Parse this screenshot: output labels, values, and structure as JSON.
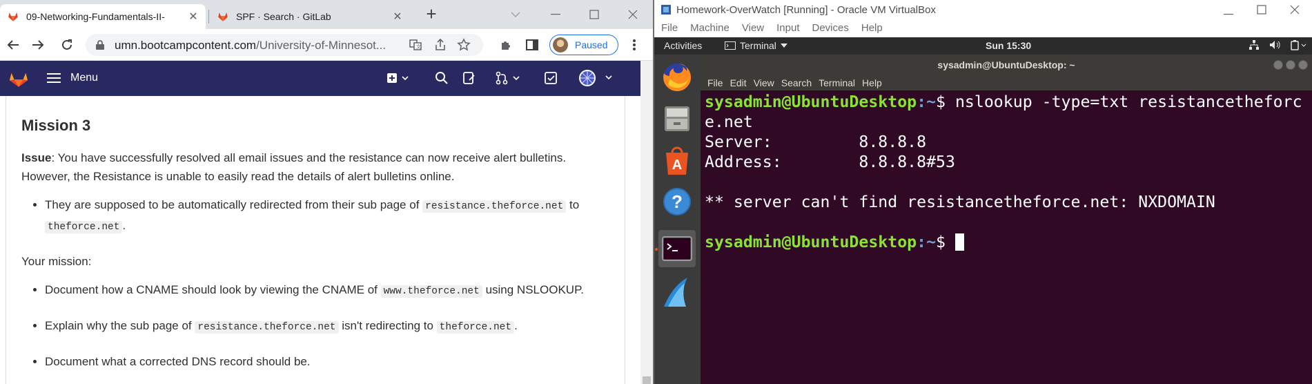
{
  "browser": {
    "tabs": [
      {
        "title": "09-Networking-Fundamentals-II-",
        "active": true
      },
      {
        "title": "SPF · Search · GitLab",
        "active": false
      }
    ],
    "address": {
      "host": "umn.bootcampcontent.com",
      "path": "/University-of-Minnesot..."
    },
    "profile": {
      "status": "Paused"
    },
    "gitlab_nav": {
      "menu_label": "Menu"
    }
  },
  "doc": {
    "heading": "Mission 3",
    "issue_label": "Issue",
    "issue_text": ": You have successfully resolved all email issues and the resistance can now receive alert bulletins. However, the Resistance is unable to easily read the details of alert bulletins online.",
    "bullet1": {
      "pre": "They are supposed to be automatically redirected from their sub page of ",
      "code1": "resistance.theforce.net",
      "mid": " to ",
      "code2": "theforce.net",
      "post": "."
    },
    "your_mission": "Your mission:",
    "bullet2": {
      "pre": "Document how a CNAME should look by viewing the CNAME of ",
      "code": "www.theforce.net",
      "post": " using NSLOOKUP."
    },
    "bullet3": {
      "pre": "Explain why the sub page of ",
      "code1": "resistance.theforce.net",
      "mid": " isn't redirecting to ",
      "code2": "theforce.net",
      "post": "."
    },
    "bullet4": "Document what a corrected DNS record should be."
  },
  "vbox": {
    "window_title": "Homework-OverWatch [Running] - Oracle VM VirtualBox",
    "menu": [
      "File",
      "Machine",
      "View",
      "Input",
      "Devices",
      "Help"
    ]
  },
  "ubuntu": {
    "activities": "Activities",
    "app_menu": "Terminal",
    "clock": "Sun 15:30",
    "dock": [
      "firefox-icon",
      "files-icon",
      "software-center-icon",
      "help-icon",
      "terminal-icon",
      "wireshark-icon"
    ]
  },
  "terminal": {
    "title": "sysadmin@UbuntuDesktop: ~",
    "menu": [
      "File",
      "Edit",
      "View",
      "Search",
      "Terminal",
      "Help"
    ],
    "prompt_user": "sysadmin@UbuntuDesktop",
    "prompt_path": ":~",
    "prompt_symbol": "$ ",
    "command_line1": "nslookup -type=txt resistancetheforc",
    "command_line2": "e.net",
    "server_line": "Server:         8.8.8.8",
    "address_line": "Address:        8.8.8.8#53",
    "error_line": "** server can't find resistancetheforce.net: NXDOMAIN"
  },
  "colors": {
    "gitlab_nav": "#292961",
    "terminal_bg": "#300a24",
    "prompt_user": "#8ae234",
    "prompt_path": "#729fcf",
    "gitlab_orange": "#e24329"
  }
}
